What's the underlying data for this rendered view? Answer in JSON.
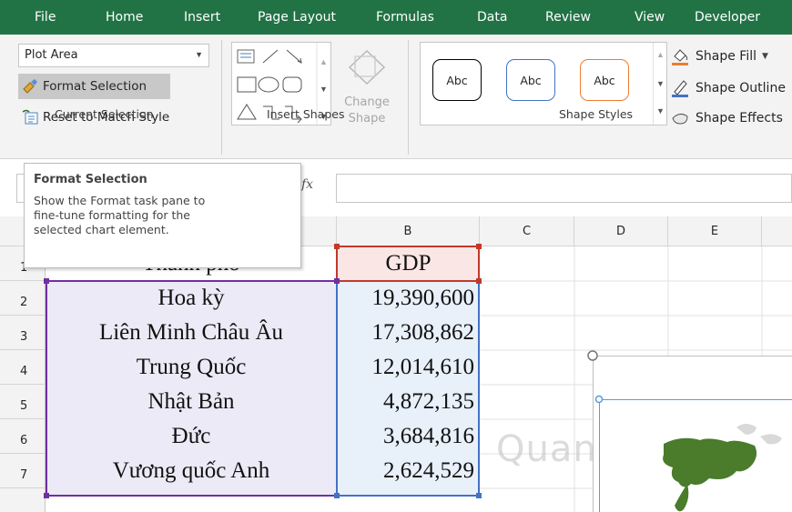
{
  "ribbon": {
    "tabs": [
      {
        "label": "File"
      },
      {
        "label": "Home"
      },
      {
        "label": "Insert"
      },
      {
        "label": "Page Layout"
      },
      {
        "label": "Formulas"
      },
      {
        "label": "Data"
      },
      {
        "label": "Review"
      },
      {
        "label": "View"
      },
      {
        "label": "Developer"
      }
    ],
    "current_selection": {
      "element_value": "Plot Area",
      "format_selection_label": "Format Selection",
      "reset_label": "Reset to Match Style",
      "group_label": "Current Selection"
    },
    "insert_shapes": {
      "change_shape_label": "Change\nShape",
      "group_label": "Insert Shapes"
    },
    "shape_styles": {
      "presets": [
        {
          "label": "Abc",
          "border_color": "#000000"
        },
        {
          "label": "Abc",
          "border_color": "#4472c4"
        },
        {
          "label": "Abc",
          "border_color": "#ed7d31"
        }
      ],
      "fill_label": "Shape Fill",
      "outline_label": "Shape Outline",
      "effects_label": "Shape Effects",
      "group_label": "Shape Styles"
    }
  },
  "formula_bar": {
    "fx_label": "fx"
  },
  "tooltip": {
    "title": "Format Selection",
    "body": "Show the Format task pane to\nfine-tune formatting for the\nselected chart element."
  },
  "sheet": {
    "columns": [
      "B",
      "C",
      "D",
      "E"
    ],
    "row_numbers": [
      "1",
      "2",
      "3",
      "4",
      "5",
      "6",
      "7"
    ],
    "header_row": {
      "col_a": "Thành phố",
      "col_b": "GDP"
    },
    "rows": [
      {
        "col_a": "Hoa kỳ",
        "col_b": "19,390,600"
      },
      {
        "col_a": "Liên Minh Châu Âu",
        "col_b": "17,308,862"
      },
      {
        "col_a": "Trung Quốc",
        "col_b": "12,014,610"
      },
      {
        "col_a": "Nhật Bản",
        "col_b": "4,872,135"
      },
      {
        "col_a": "Đức",
        "col_b": "3,684,816"
      },
      {
        "col_a": "Vương quốc Anh",
        "col_b": "2,624,529"
      }
    ]
  },
  "colors": {
    "ribbon_green": "#217346",
    "range_purple": "#7030a0",
    "range_blue": "#4472c4",
    "range_red": "#c0392b",
    "map_green": "#4a7c2b"
  },
  "watermark": "Quantrimang"
}
